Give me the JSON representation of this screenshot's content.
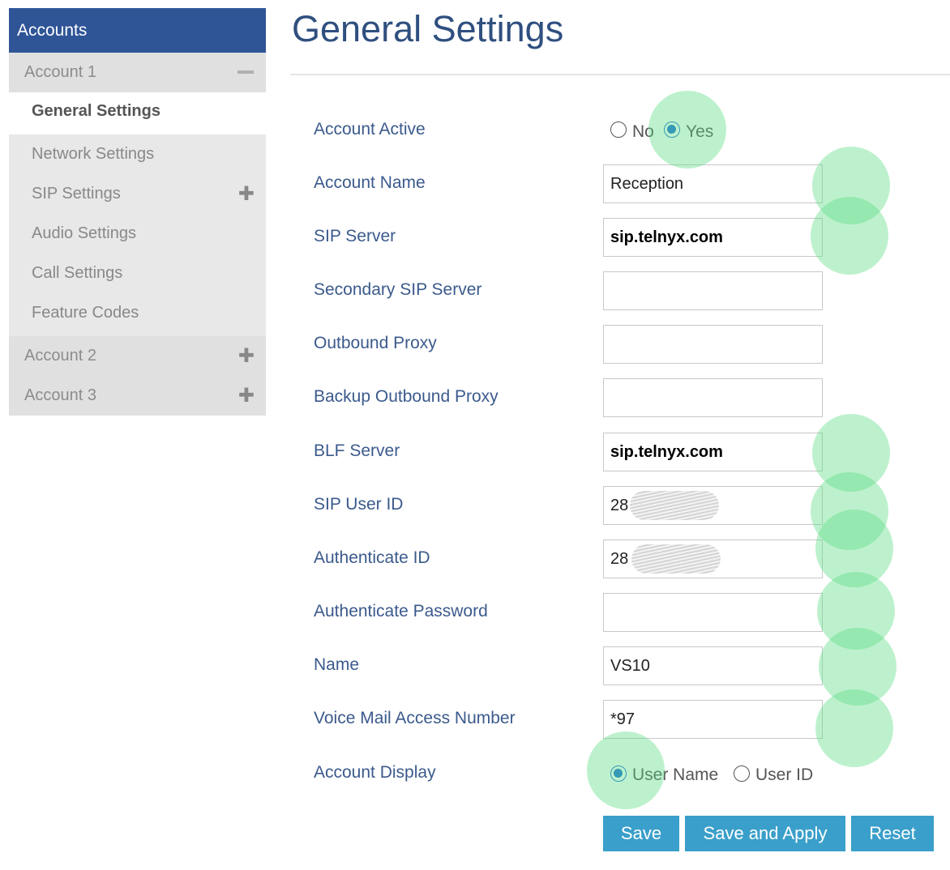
{
  "sidebar": {
    "header": "Accounts",
    "account1": "Account 1",
    "items": [
      "General Settings",
      "Network Settings",
      "SIP Settings",
      "Audio Settings",
      "Call Settings",
      "Feature Codes"
    ],
    "account2": "Account 2",
    "account3": "Account 3",
    "active_item": "General Settings"
  },
  "page": {
    "title": "General Settings"
  },
  "form": {
    "account_active": {
      "label": "Account Active",
      "options": [
        "No",
        "Yes"
      ],
      "selected": "Yes"
    },
    "account_name": {
      "label": "Account Name",
      "value": "Reception"
    },
    "sip_server": {
      "label": "SIP Server",
      "value": "sip.telnyx.com"
    },
    "secondary_sip_server": {
      "label": "Secondary SIP Server",
      "value": ""
    },
    "outbound_proxy": {
      "label": "Outbound Proxy",
      "value": ""
    },
    "backup_outbound_proxy": {
      "label": "Backup Outbound Proxy",
      "value": ""
    },
    "blf_server": {
      "label": "BLF Server",
      "value": "sip.telnyx.com"
    },
    "sip_user_id": {
      "label": "SIP User ID",
      "value": "28"
    },
    "authenticate_id": {
      "label": "Authenticate ID",
      "value": "28"
    },
    "authenticate_password": {
      "label": "Authenticate Password",
      "value": ""
    },
    "name": {
      "label": "Name",
      "value": "VS10"
    },
    "voice_mail_access_number": {
      "label": "Voice Mail Access Number",
      "value": "*97"
    },
    "account_display": {
      "label": "Account Display",
      "options": [
        "User Name",
        "User ID"
      ],
      "selected": "User Name"
    }
  },
  "buttons": {
    "save": "Save",
    "save_and_apply": "Save and Apply",
    "reset": "Reset"
  },
  "colors": {
    "sidebar_header": "#2f5597",
    "title": "#2f4f7f",
    "label": "#3b5a8c",
    "button": "#3a9fca",
    "highlight": "#5adc82",
    "radio_selected": "#1e6fd9"
  },
  "icons": {
    "expanded": "minus-icon",
    "collapsed": "plus-icon"
  }
}
